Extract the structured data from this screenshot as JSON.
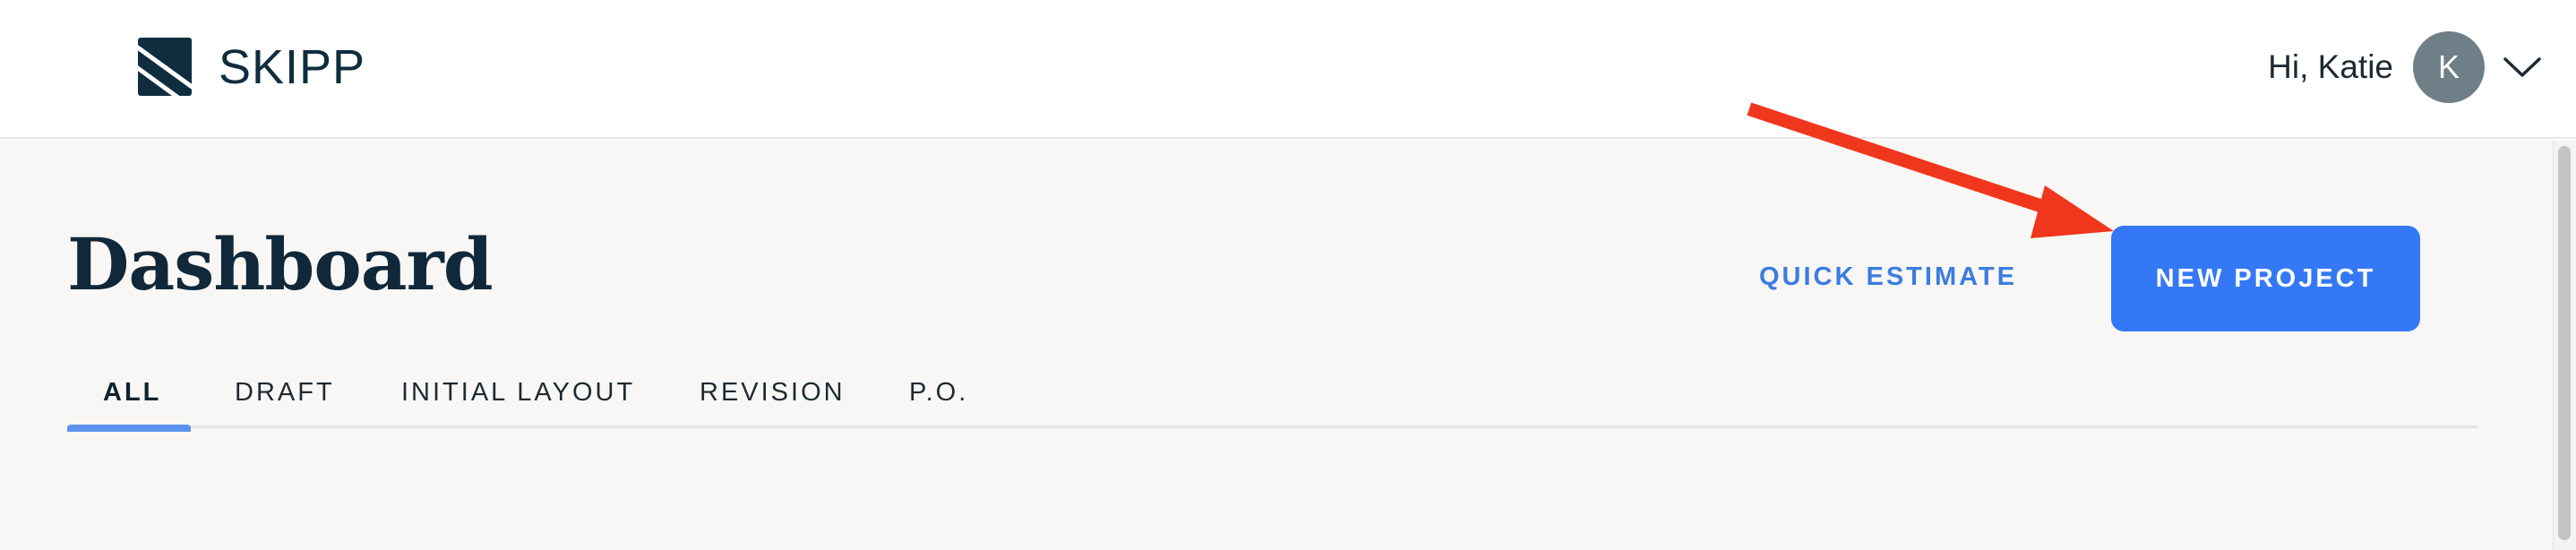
{
  "header": {
    "logo_text": "SKIPP",
    "greeting": "Hi, Katie",
    "avatar_initial": "K"
  },
  "page": {
    "title": "Dashboard",
    "quick_estimate_label": "QUICK ESTIMATE",
    "new_project_label": "NEW PROJECT"
  },
  "tabs": [
    {
      "label": "ALL",
      "active": true
    },
    {
      "label": "DRAFT",
      "active": false
    },
    {
      "label": "INITIAL LAYOUT",
      "active": false
    },
    {
      "label": "REVISION",
      "active": false
    },
    {
      "label": "P.O.",
      "active": false
    }
  ],
  "colors": {
    "accent": "#3478f6",
    "annotation_arrow": "#f0361c",
    "navy": "#0f2d3e"
  },
  "icons": {
    "logo": "skipp-logo-icon",
    "user_menu": "chevron-down-icon"
  }
}
